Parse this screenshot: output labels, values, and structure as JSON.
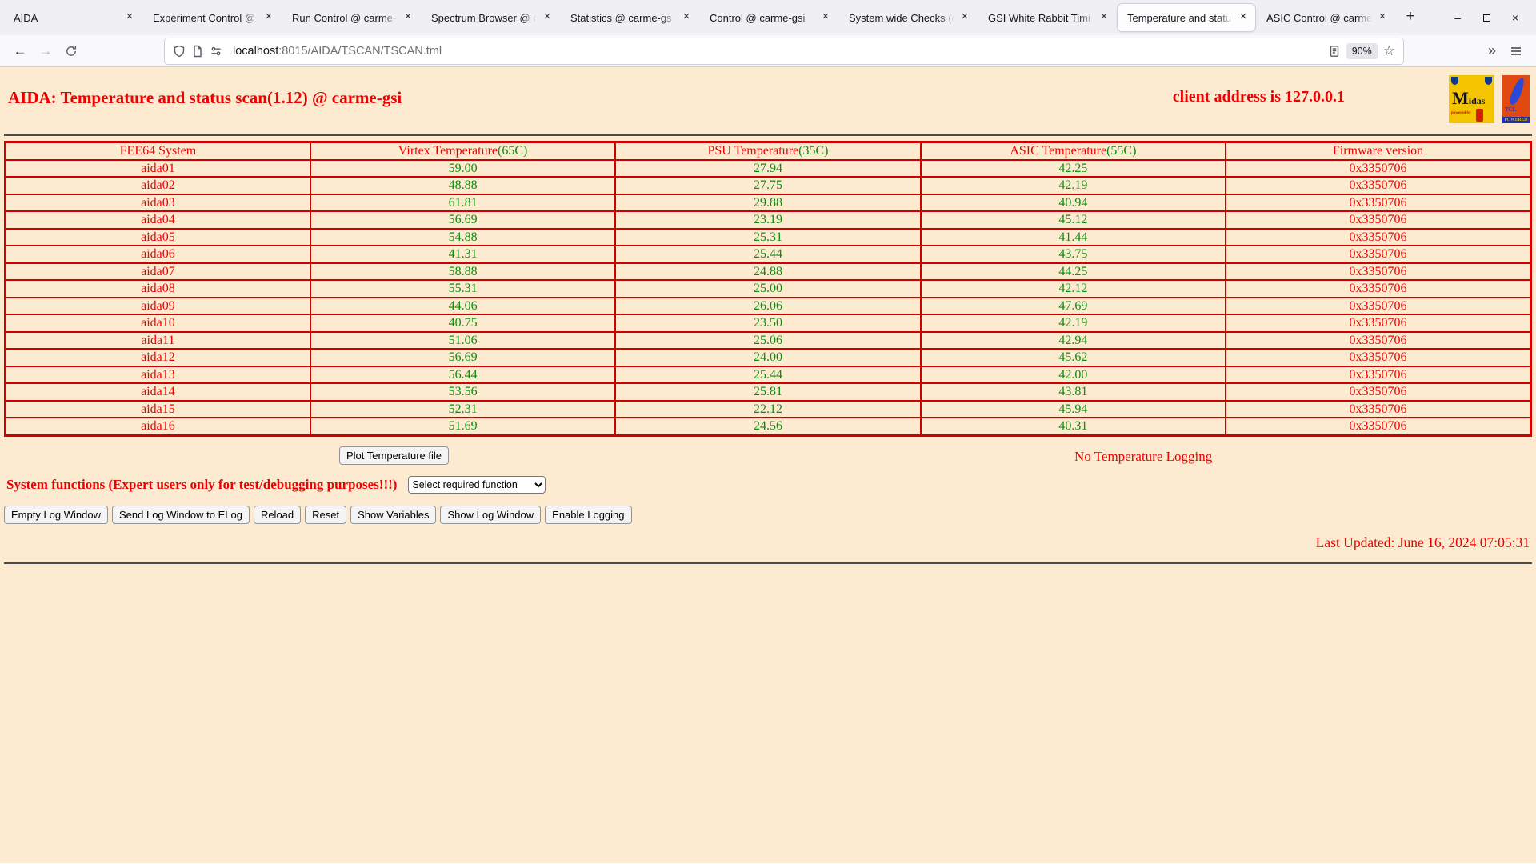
{
  "browser": {
    "tabs": [
      {
        "label": "AIDA",
        "active": false
      },
      {
        "label": "Experiment Control @ ca",
        "active": false
      },
      {
        "label": "Run Control @ carme-g",
        "active": false
      },
      {
        "label": "Spectrum Browser @ ca",
        "active": false
      },
      {
        "label": "Statistics @ carme-gs",
        "active": false
      },
      {
        "label": "Control @ carme-gsi",
        "active": false
      },
      {
        "label": "System wide Checks (c",
        "active": false
      },
      {
        "label": "GSI White Rabbit Timi",
        "active": false
      },
      {
        "label": "Temperature and statu",
        "active": true
      },
      {
        "label": "ASIC Control @ carme",
        "active": false
      }
    ],
    "tab_close_glyph": "×",
    "new_tab_glyph": "+",
    "window": {
      "minimize_glyph": "–",
      "close_glyph": "×"
    },
    "toolbar": {
      "back_glyph": "←",
      "forward_glyph": "→",
      "overflow_glyph": "»",
      "star_glyph": "☆"
    },
    "url": {
      "host": "localhost",
      "rest": ":8015/AIDA/TSCAN/TSCAN.tml"
    },
    "zoom_badge": "90%"
  },
  "header": {
    "title": "AIDA: Temperature and status scan(1.12) @ carme-gsi",
    "client_address": "client address is 127.0.0.1",
    "logos": {
      "midas": "Midas",
      "midas_sub": "powered by",
      "tcl": "TCL",
      "tcl_sub": "POWERED"
    }
  },
  "table": {
    "columns": [
      {
        "label": "FEE64 System"
      },
      {
        "label": "Virtex Temperature",
        "limit": "(65C)"
      },
      {
        "label": "PSU Temperature",
        "limit": "(35C)"
      },
      {
        "label": "ASIC Temperature",
        "limit": "(55C)"
      },
      {
        "label": "Firmware version"
      }
    ],
    "rows": [
      {
        "name": "aida01",
        "virtex": "59.00",
        "psu": "27.94",
        "asic": "42.25",
        "firmware": "0x3350706"
      },
      {
        "name": "aida02",
        "virtex": "48.88",
        "psu": "27.75",
        "asic": "42.19",
        "firmware": "0x3350706"
      },
      {
        "name": "aida03",
        "virtex": "61.81",
        "psu": "29.88",
        "asic": "40.94",
        "firmware": "0x3350706"
      },
      {
        "name": "aida04",
        "virtex": "56.69",
        "psu": "23.19",
        "asic": "45.12",
        "firmware": "0x3350706"
      },
      {
        "name": "aida05",
        "virtex": "54.88",
        "psu": "25.31",
        "asic": "41.44",
        "firmware": "0x3350706"
      },
      {
        "name": "aida06",
        "virtex": "41.31",
        "psu": "25.44",
        "asic": "43.75",
        "firmware": "0x3350706"
      },
      {
        "name": "aida07",
        "virtex": "58.88",
        "psu": "24.88",
        "asic": "44.25",
        "firmware": "0x3350706"
      },
      {
        "name": "aida08",
        "virtex": "55.31",
        "psu": "25.00",
        "asic": "42.12",
        "firmware": "0x3350706"
      },
      {
        "name": "aida09",
        "virtex": "44.06",
        "psu": "26.06",
        "asic": "47.69",
        "firmware": "0x3350706"
      },
      {
        "name": "aida10",
        "virtex": "40.75",
        "psu": "23.50",
        "asic": "42.19",
        "firmware": "0x3350706"
      },
      {
        "name": "aida11",
        "virtex": "51.06",
        "psu": "25.06",
        "asic": "42.94",
        "firmware": "0x3350706"
      },
      {
        "name": "aida12",
        "virtex": "56.69",
        "psu": "24.00",
        "asic": "45.62",
        "firmware": "0x3350706"
      },
      {
        "name": "aida13",
        "virtex": "56.44",
        "psu": "25.44",
        "asic": "42.00",
        "firmware": "0x3350706"
      },
      {
        "name": "aida14",
        "virtex": "53.56",
        "psu": "25.81",
        "asic": "43.81",
        "firmware": "0x3350706"
      },
      {
        "name": "aida15",
        "virtex": "52.31",
        "psu": "22.12",
        "asic": "45.94",
        "firmware": "0x3350706"
      },
      {
        "name": "aida16",
        "virtex": "51.69",
        "psu": "24.56",
        "asic": "40.31",
        "firmware": "0x3350706"
      }
    ]
  },
  "controls": {
    "plot_button": "Plot Temperature file",
    "logging_status": "No Temperature Logging",
    "system_functions_label": "System functions (Expert users only for test/debugging purposes!!!)",
    "function_select": "Select required function",
    "buttons": [
      {
        "label": "Empty Log Window"
      },
      {
        "label": "Send Log Window to ELog"
      },
      {
        "label": "Reload"
      },
      {
        "label": "Reset"
      },
      {
        "label": "Show Variables"
      },
      {
        "label": "Show Log Window"
      },
      {
        "label": "Enable Logging"
      }
    ]
  },
  "footer": {
    "last_updated": "Last Updated: June 16, 2024 07:05:31"
  }
}
